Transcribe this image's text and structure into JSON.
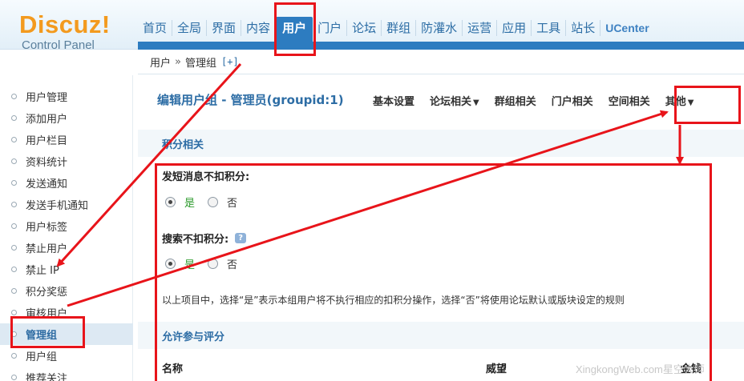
{
  "logo": {
    "main": "Discuz!",
    "sub": "Control Panel"
  },
  "topnav": {
    "items": [
      "首页",
      "全局",
      "界面",
      "内容",
      "用户",
      "门户",
      "论坛",
      "群组",
      "防灌水",
      "运营",
      "应用",
      "工具",
      "站长",
      "UCenter"
    ],
    "active_index": 4
  },
  "breadcrumb": {
    "part1": "用户",
    "sep": "»",
    "part2": "管理组",
    "plus": "[+]"
  },
  "sidebar": {
    "items": [
      "用户管理",
      "添加用户",
      "用户栏目",
      "资料统计",
      "发送通知",
      "发送手机通知",
      "用户标签",
      "禁止用户",
      "禁止 IP",
      "积分奖惩",
      "审核用户",
      "管理组",
      "用户组",
      "推荐关注"
    ],
    "active_index": 11
  },
  "main": {
    "title": "编辑用户组 - 管理员(groupid:1)",
    "subtabs": [
      "基本设置",
      "论坛相关",
      "群组相关",
      "门户相关",
      "空间相关",
      "其他"
    ],
    "dropdown_tabs": [
      1,
      5
    ],
    "section1": "积分相关",
    "field1": {
      "label": "发短消息不扣积分:",
      "yes": "是",
      "no": "否",
      "value": "是"
    },
    "field2": {
      "label": "搜索不扣积分:",
      "help": "?",
      "yes": "是",
      "no": "否",
      "value": "是"
    },
    "note": "以上项目中，选择“是”表示本组用户将不执行相应的扣积分操作，选择“否”将使用论坛默认或版块设定的规则",
    "section2": "允许参与评分",
    "columns": [
      "名称",
      "威望",
      "金钱"
    ]
  },
  "watermark": "XingkongWeb.com星空大师",
  "colors": {
    "accent": "#2d7cc0",
    "annotation": "#e8141a",
    "logo": "#f39a1e"
  }
}
